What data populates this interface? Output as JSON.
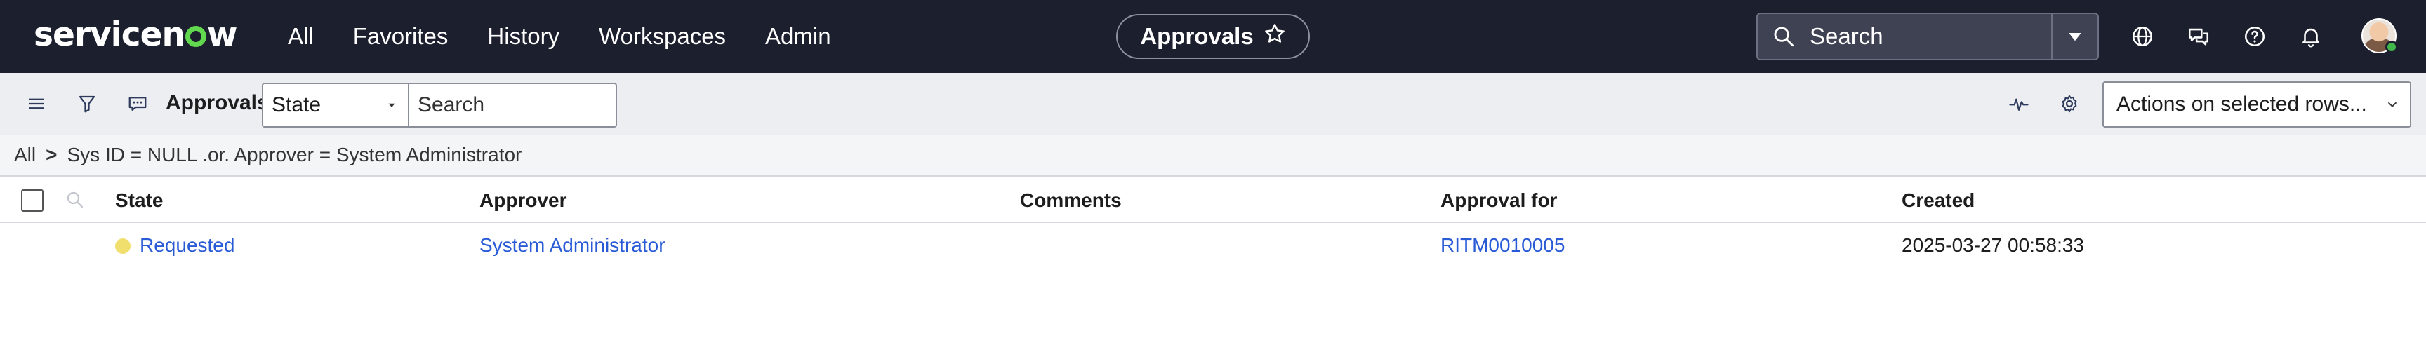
{
  "topnav": {
    "logo_text_a": "service",
    "logo_text_b": "w",
    "logo_text_n": "n",
    "links": [
      "All",
      "Favorites",
      "History",
      "Workspaces",
      "Admin"
    ],
    "context_title": "Approvals",
    "search_placeholder": "Search",
    "icons": [
      "globe-icon",
      "chat-icon",
      "help-icon",
      "bell-icon"
    ],
    "status_color": "#3fb74a"
  },
  "toolbar": {
    "list_title": "Approvals",
    "field_select": "State",
    "search_placeholder": "Search",
    "actions_select": "Actions on selected rows..."
  },
  "breadcrumb": {
    "root": "All",
    "separator": ">",
    "condition": "Sys ID = NULL .or. Approver = System Administrator"
  },
  "table": {
    "columns": [
      "State",
      "Approver",
      "Comments",
      "Approval for",
      "Created"
    ],
    "rows": [
      {
        "state": "Requested",
        "approver": "System Administrator",
        "comments": "",
        "approval_for": "RITM0010005",
        "created": "2025-03-27 00:58:33"
      }
    ]
  },
  "colors": {
    "header_bg": "#1c1f2e",
    "link": "#2a5bd7",
    "state_requested": "#f0df6c",
    "brand_green": "#62d84e"
  }
}
